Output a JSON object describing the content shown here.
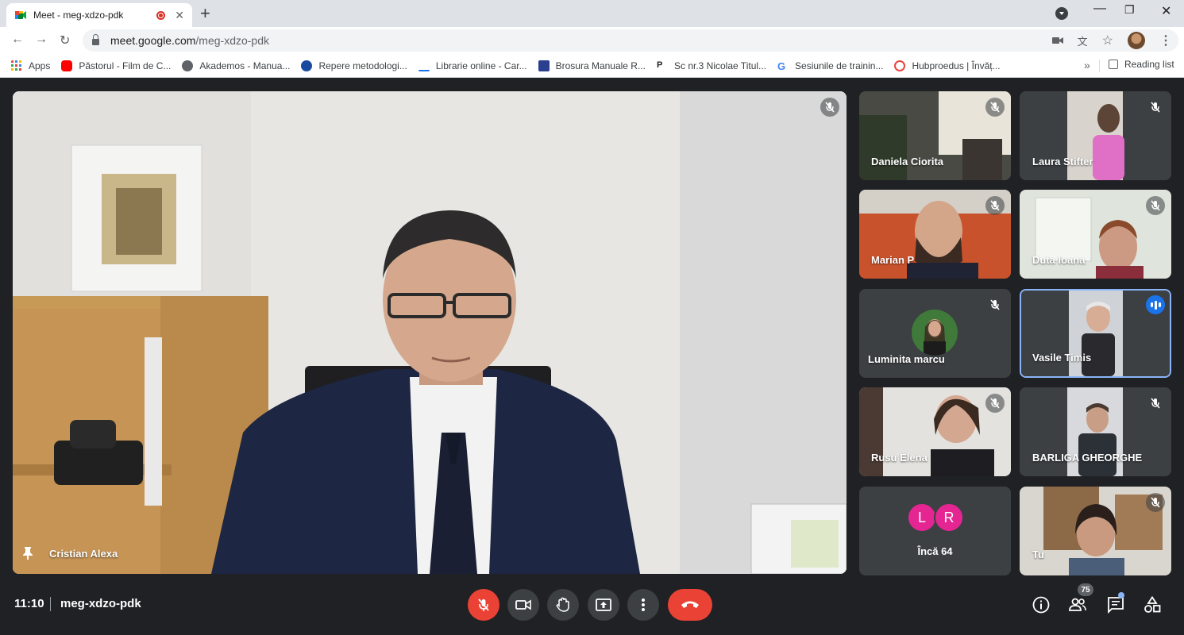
{
  "browser": {
    "tab_title": "Meet - meg-xdzo-pdk",
    "url_host": "meet.google.com",
    "url_path": "/meg-xdzo-pdk",
    "bookmarks": [
      {
        "label": "Apps",
        "icon": "apps-grid-icon"
      },
      {
        "label": "Păstorul - Film de C...",
        "icon": "youtube-icon"
      },
      {
        "label": "Akademos - Manua...",
        "icon": "globe-icon"
      },
      {
        "label": "Repere metodologi...",
        "icon": "ministry-crest-icon"
      },
      {
        "label": "Librarie online - Car...",
        "icon": "libris-icon"
      },
      {
        "label": "Brosura Manuale R...",
        "icon": "brochure-icon"
      },
      {
        "label": "Sc nr.3 Nicolae Titul...",
        "icon": "p-letter-icon"
      },
      {
        "label": "Sesiunile de trainin...",
        "icon": "google-icon"
      },
      {
        "label": "Hubproedus | Învăț...",
        "icon": "hubproedus-icon"
      }
    ],
    "more_bookmarks": "»",
    "reading_list": "Reading list"
  },
  "meet": {
    "main_speaker": "Cristian Alexa",
    "tiles": [
      {
        "name": "Daniela Ciorita",
        "muted": true
      },
      {
        "name": "Laura Stifter",
        "muted": true
      },
      {
        "name": "Marian P",
        "muted": true
      },
      {
        "name": "Duta Ioana",
        "muted": true
      },
      {
        "name": "Luminita marcu",
        "muted": true
      },
      {
        "name": "Vasile Timis",
        "muted": false,
        "speaking": true
      },
      {
        "name": "Rusu Elena",
        "muted": true
      },
      {
        "name": "BARLIGA GHEORGHE",
        "muted": true
      },
      {
        "name": "Tu",
        "muted": true
      }
    ],
    "more_tile": {
      "initials": [
        "L",
        "R"
      ],
      "label": "Încă 64"
    },
    "clock": "11:10",
    "meeting_code": "meg-xdzo-pdk",
    "participant_count": "75",
    "colors": {
      "end_call": "#ea4335",
      "speaking": "#1a73e8",
      "more_avatar": "#e52592",
      "active_border": "#8ab4f8"
    }
  }
}
